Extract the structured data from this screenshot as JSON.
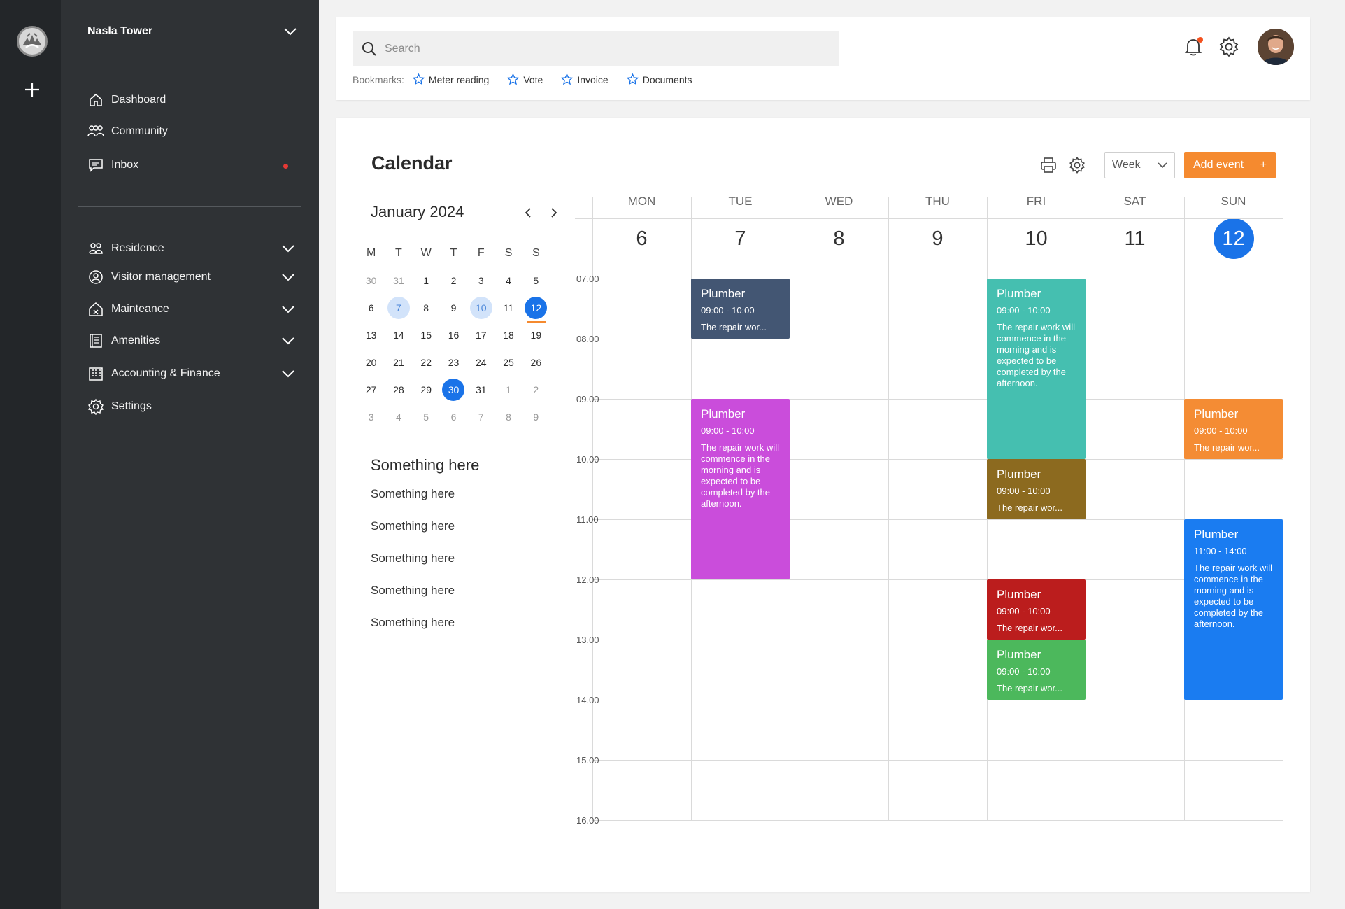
{
  "sidebar": {
    "org_name": "Nasla Tower",
    "nav": [
      {
        "label": "Dashboard"
      },
      {
        "label": "Community"
      },
      {
        "label": "Inbox"
      }
    ],
    "groups": [
      {
        "label": "Residence"
      },
      {
        "label": "Visitor management"
      },
      {
        "label": "Mainteance"
      },
      {
        "label": "Amenities"
      },
      {
        "label": "Accounting & Finance"
      },
      {
        "label": "Settings"
      }
    ]
  },
  "topbar": {
    "search_placeholder": "Search",
    "bookmarks_label": "Bookmarks:",
    "bookmarks": [
      "Meter reading",
      "Vote",
      "Invoice",
      "Documents"
    ]
  },
  "calendar": {
    "title": "Calendar",
    "view": "Week",
    "add_label": "Add event",
    "add_icon": "+",
    "mini": {
      "month": "January 2024",
      "weekdays": [
        "M",
        "T",
        "W",
        "T",
        "F",
        "S",
        "S"
      ],
      "weeks": [
        [
          "30",
          "31",
          "1",
          "2",
          "3",
          "4",
          "5"
        ],
        [
          "6",
          "7",
          "8",
          "9",
          "10",
          "11",
          "12"
        ],
        [
          "13",
          "14",
          "15",
          "16",
          "17",
          "18",
          "19"
        ],
        [
          "20",
          "21",
          "22",
          "23",
          "24",
          "25",
          "26"
        ],
        [
          "27",
          "28",
          "29",
          "30",
          "31",
          "1",
          "2"
        ],
        [
          "3",
          "4",
          "5",
          "6",
          "7",
          "8",
          "9"
        ]
      ]
    },
    "side_title": "Something here",
    "side_lines": [
      "Something here",
      "Something here",
      "Something here",
      "Something here",
      "Something here"
    ],
    "days": [
      {
        "name": "MON",
        "num": "6"
      },
      {
        "name": "TUE",
        "num": "7"
      },
      {
        "name": "WED",
        "num": "8"
      },
      {
        "name": "THU",
        "num": "9"
      },
      {
        "name": "FRI",
        "num": "10"
      },
      {
        "name": "SAT",
        "num": "11"
      },
      {
        "name": "SUN",
        "num": "12"
      }
    ],
    "times": [
      "07.00",
      "08.00",
      "09.00",
      "10.00",
      "11.00",
      "12.00",
      "13.00",
      "14.00",
      "15.00",
      "16.00"
    ],
    "events": [
      {
        "day": 1,
        "start": 7,
        "end": 8,
        "title": "Plumber",
        "time": "09:00 - 10:00",
        "desc": "The repair wor...",
        "color": "#435673"
      },
      {
        "day": 1,
        "start": 9,
        "end": 12,
        "title": "Plumber",
        "time": "09:00 - 10:00",
        "desc": "The repair work will commence in the morning and is expected to be completed by the afternoon.",
        "color": "#ca4ddb"
      },
      {
        "day": 4,
        "start": 7,
        "end": 10,
        "title": "Plumber",
        "time": "09:00 - 10:00",
        "desc": "The repair work will commence in the morning and is expected to be completed by the afternoon.",
        "color": "#45bfb0"
      },
      {
        "day": 4,
        "start": 10,
        "end": 11,
        "title": "Plumber",
        "time": "09:00 - 10:00",
        "desc": "The repair wor...",
        "color": "#8c6a1f"
      },
      {
        "day": 4,
        "start": 12,
        "end": 13,
        "title": "Plumber",
        "time": "09:00 - 10:00",
        "desc": "The repair wor...",
        "color": "#bb1d1d"
      },
      {
        "day": 4,
        "start": 13,
        "end": 14,
        "title": "Plumber",
        "time": "09:00 - 10:00",
        "desc": "The repair wor...",
        "color": "#4cb85c"
      },
      {
        "day": 6,
        "start": 9,
        "end": 10,
        "title": "Plumber",
        "time": "09:00 - 10:00",
        "desc": "The repair wor...",
        "color": "#f48c34"
      },
      {
        "day": 6,
        "start": 11,
        "end": 14,
        "title": "Plumber",
        "time": "11:00 - 14:00",
        "desc": "The repair work will commence in the morning and is expected to be completed by the afternoon.",
        "color": "#1a7cf1"
      }
    ]
  }
}
